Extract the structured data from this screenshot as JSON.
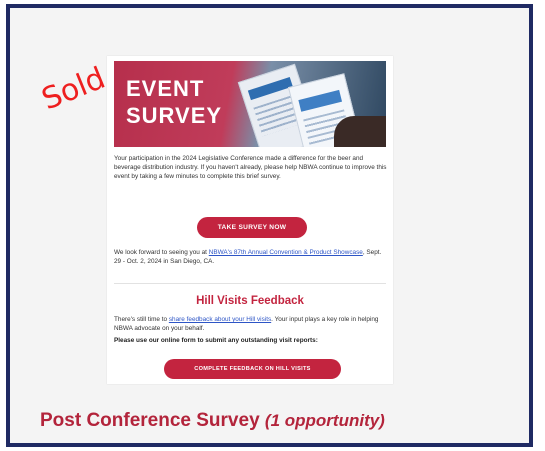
{
  "email": {
    "banner": {
      "line1": "EVENT",
      "line2": "SURVEY"
    },
    "intro": "Your participation in the 2024 Legislative Conference made a difference for the beer and beverage distribution industry. If you haven't already, please help NBWA continue to improve this event by taking a few minutes to complete this brief survey.",
    "survey_button": "TAKE SURVEY NOW",
    "lookforward_pre": "We look forward to seeing you at ",
    "lookforward_link": "NBWA's 87th Annual Convention & Product Showcase",
    "lookforward_post": ", Sept. 29 - Oct. 2, 2024 in San Diego, CA.",
    "section_title": "Hill Visits Feedback",
    "hill_pre": "There's still time to ",
    "hill_link": "share feedback about your Hill visits",
    "hill_post": ". Your input plays a key role in helping NBWA advocate on your behalf.",
    "form_prompt": "Please use our online form to submit any outstanding visit reports:",
    "feedback_button": "COMPLETE FEEDBACK ON HILL VISITS"
  },
  "overlay": {
    "sold_label": "Sold"
  },
  "caption": {
    "title": "Post Conference Survey",
    "note": "(1 opportunity)"
  },
  "colors": {
    "frame_border": "#1f2a63",
    "accent": "#c3243f",
    "sold": "#ee1f1f",
    "link": "#2d55c6"
  }
}
